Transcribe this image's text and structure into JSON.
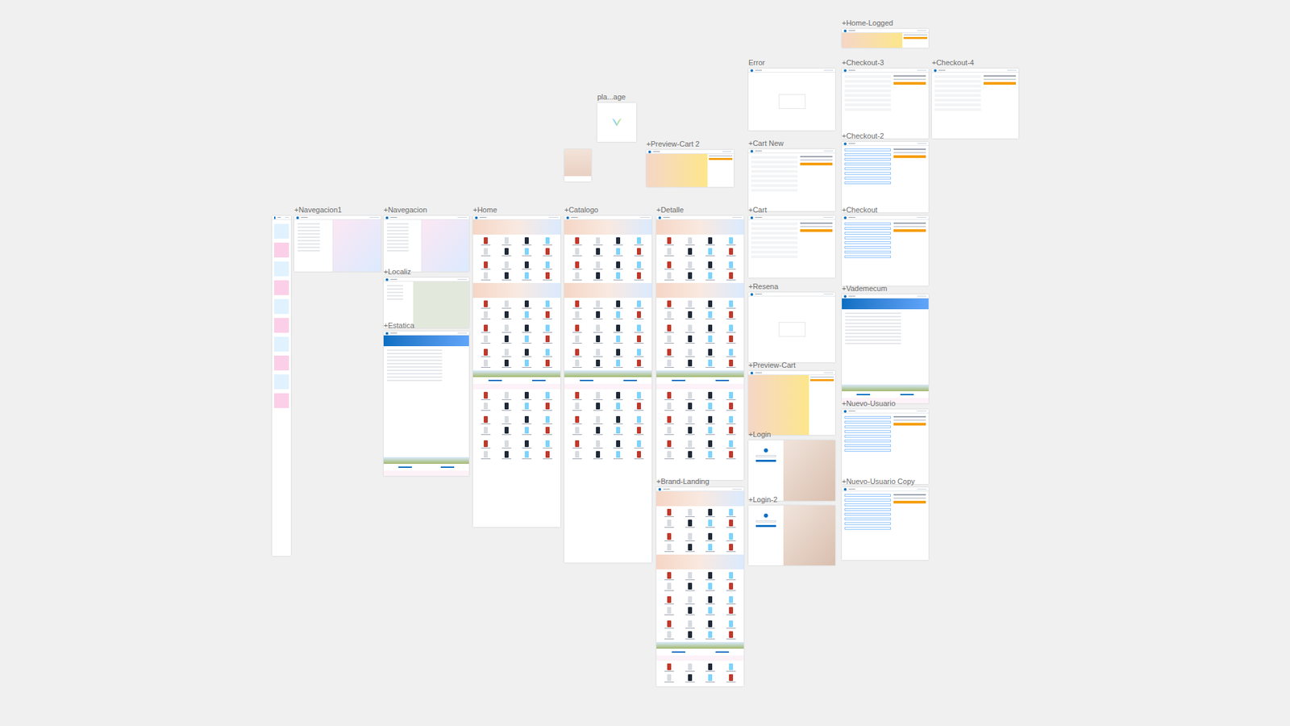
{
  "canvas": {
    "artboards": [
      {
        "label": "+Home-Logged",
        "kind": "banner"
      },
      {
        "label": "Error",
        "kind": "blank"
      },
      {
        "label": "+Checkout-3",
        "kind": "checkout"
      },
      {
        "label": "+Checkout-4",
        "kind": "checkout"
      },
      {
        "label": "pla...age",
        "kind": "logo"
      },
      {
        "label": "",
        "kind": "photo"
      },
      {
        "label": "+Preview-Cart 2",
        "kind": "banner"
      },
      {
        "label": "+Cart New",
        "kind": "checkout"
      },
      {
        "label": "+Checkout-2",
        "kind": "form"
      },
      {
        "label": "",
        "kind": "mobile"
      },
      {
        "label": "+Navegacion1",
        "kind": "menu"
      },
      {
        "label": "+Navegacion",
        "kind": "menu"
      },
      {
        "label": "+Home",
        "kind": "page"
      },
      {
        "label": "+Catalogo",
        "kind": "page"
      },
      {
        "label": "+Detalle",
        "kind": "page"
      },
      {
        "label": "+Cart",
        "kind": "checkout"
      },
      {
        "label": "+Checkout",
        "kind": "form"
      },
      {
        "label": "+Localiz",
        "kind": "map"
      },
      {
        "label": "+Estatica",
        "kind": "static"
      },
      {
        "label": "+Resena",
        "kind": "blank"
      },
      {
        "label": "+Vademecum",
        "kind": "static"
      },
      {
        "label": "+Preview-Cart",
        "kind": "banner"
      },
      {
        "label": "+Nuevo-Usuario",
        "kind": "form"
      },
      {
        "label": "+Login",
        "kind": "login"
      },
      {
        "label": "+Brand-Landing",
        "kind": "page"
      },
      {
        "label": "+Login-2",
        "kind": "login"
      },
      {
        "label": "+Nuevo-Usuario Copy",
        "kind": "form"
      }
    ]
  }
}
